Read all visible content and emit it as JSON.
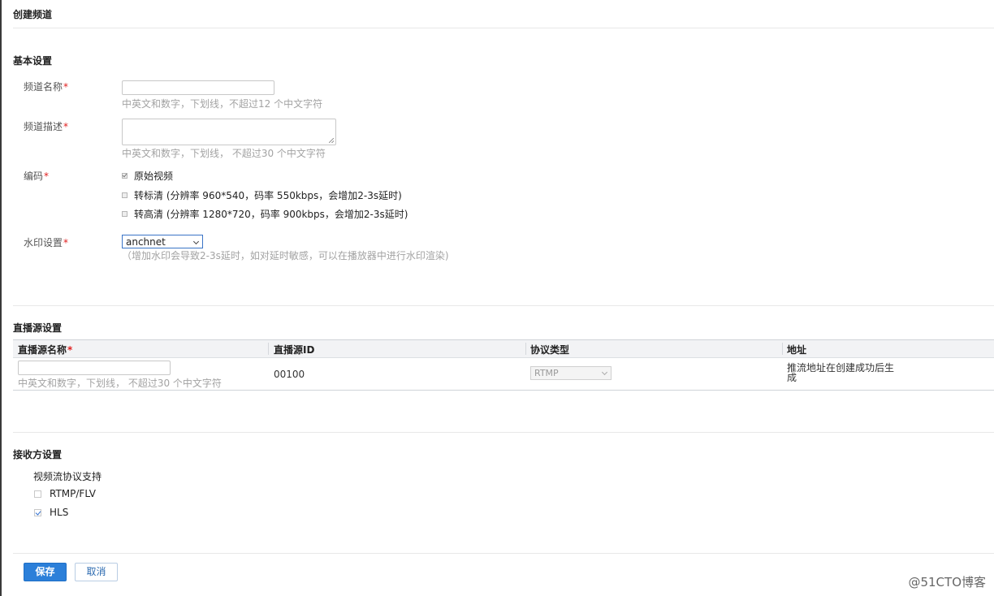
{
  "page": {
    "title": "创建频道"
  },
  "basic": {
    "section_title": "基本设置",
    "name_label": "频道名称",
    "name_value": "",
    "name_hint": "中英文和数字，下划线，不超过12 个中文字符",
    "desc_label": "频道描述",
    "desc_value": "",
    "desc_hint": "中英文和数字，下划线， 不超过30 个中文字符",
    "encode_label": "编码",
    "encode_options": [
      {
        "label": "原始视频",
        "checked": true
      },
      {
        "label": "转标清 (分辨率 960*540，码率 550kbps，会增加2-3s延时)",
        "checked": false
      },
      {
        "label": "转高清 (分辨率 1280*720，码率 900kbps，会增加2-3s延时)",
        "checked": false
      }
    ],
    "watermark_label": "水印设置",
    "watermark_value": "anchnet",
    "watermark_hint": "（增加水印会导致2-3s延时，如对延时敏感，可以在播放器中进行水印渲染)",
    "required_mark": "*"
  },
  "source": {
    "section_title": "直播源设置",
    "columns": [
      "直播源名称",
      "直播源ID",
      "协议类型",
      "地址"
    ],
    "row": {
      "name_value": "",
      "name_hint": "中英文和数字，下划线， 不超过30 个中文字符",
      "id": "00100",
      "protocol": "RTMP",
      "address_line1": "推流地址在创建成功后生",
      "address_line2": "成"
    }
  },
  "receiver": {
    "section_title": "接收方设置",
    "protocol_label": "视频流协议支持",
    "options": [
      {
        "label": "RTMP/FLV",
        "checked": false
      },
      {
        "label": "HLS",
        "checked": true
      }
    ]
  },
  "actions": {
    "save": "保存",
    "cancel": "取消"
  },
  "watermark_text": "@51CTO博客",
  "colors": {
    "primary": "#2b7fd9",
    "required": "#e02020",
    "hint": "#a3a3a3"
  }
}
